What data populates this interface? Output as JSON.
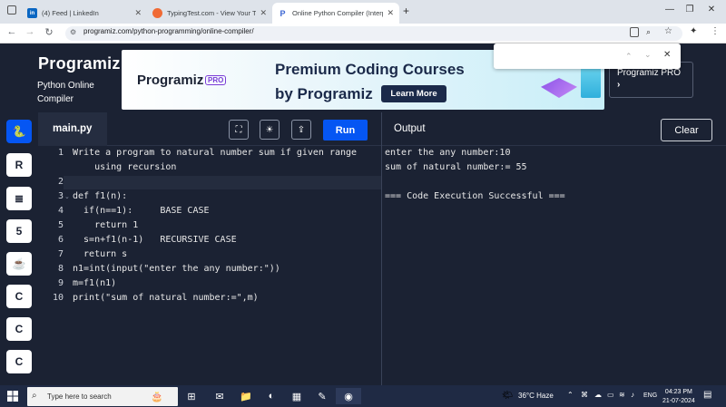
{
  "browser": {
    "tabs": [
      {
        "title": "(4) Feed | LinkedIn",
        "icon": "linkedin-icon"
      },
      {
        "title": "TypingTest.com - View Your Typ",
        "icon": "typingtest-icon"
      },
      {
        "title": "Online Python Compiler (Interp",
        "icon": "programiz-icon",
        "active": true
      }
    ],
    "new_tab": "+",
    "url": "programiz.com/python-programming/online-compiler/"
  },
  "site": {
    "logo": "Programiz",
    "subtitle": "Python Online Compiler",
    "ad": {
      "logo": "Programiz",
      "pro_badge": "PRO",
      "line1": "Premium Coding Courses",
      "line2": "by Programiz",
      "cta": "Learn More"
    },
    "pro_panel": "Programiz PRO",
    "pro_arrow": "›"
  },
  "editor": {
    "filename": "main.py",
    "run_label": "Run",
    "lines": [
      {
        "n": "1",
        "code": "Write a program to natural number sum if given range"
      },
      {
        "n": "",
        "code": "    using recursion"
      },
      {
        "n": "2",
        "code": ""
      },
      {
        "n": "3",
        "code": "def f1(n):"
      },
      {
        "n": "4",
        "code": "  if(n==1):     BASE CASE"
      },
      {
        "n": "5",
        "code": "    return 1"
      },
      {
        "n": "6",
        "code": "  s=n+f1(n-1)   RECURSIVE CASE"
      },
      {
        "n": "7",
        "code": "  return s"
      },
      {
        "n": "8",
        "code": "n1=int(input(\"enter the any number:\"))"
      },
      {
        "n": "9",
        "code": "m=f1(n1)"
      },
      {
        "n": "10",
        "code": "print(\"sum of natural number:=\",m)"
      }
    ]
  },
  "output": {
    "label": "Output",
    "clear_label": "Clear",
    "lines": [
      "enter the any number:10",
      "sum of natural number:= 55",
      "",
      "=== Code Execution Successful ==="
    ]
  },
  "taskbar": {
    "search_placeholder": "Type here to search",
    "weather": "36°C  Haze",
    "lang": "ENG",
    "time": "04:23 PM",
    "date": "21-07-2024"
  }
}
